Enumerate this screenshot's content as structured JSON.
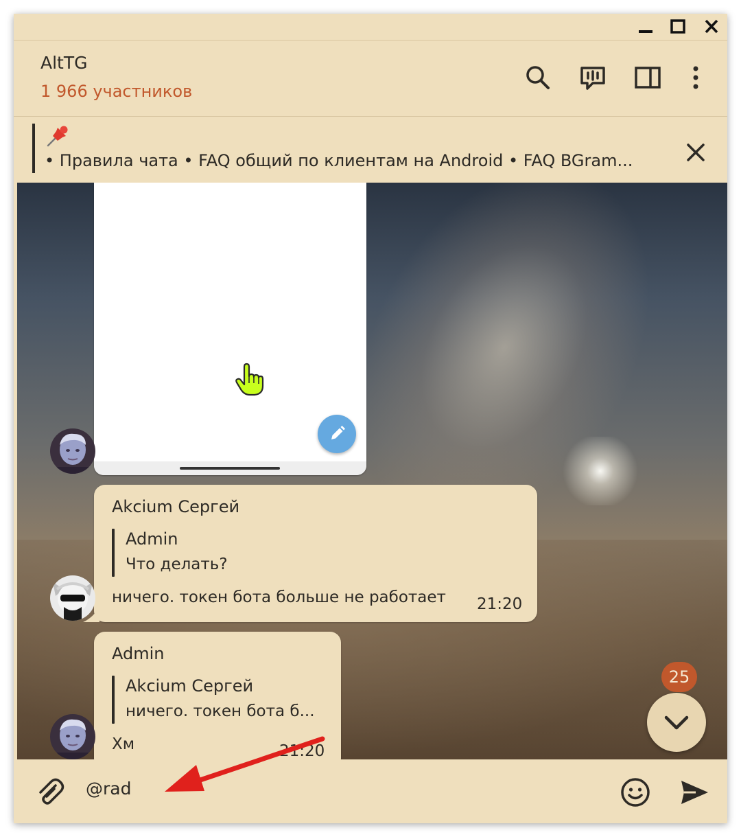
{
  "window": {
    "controls": [
      "minimize-icon",
      "maximize-icon",
      "close-icon"
    ]
  },
  "header": {
    "title": "AltTG",
    "subtitle": "1 966 участников",
    "actions": [
      "search-icon",
      "voice-chat-icon",
      "sidebar-icon",
      "more-icon"
    ]
  },
  "pinned": {
    "icon": "pushpin-icon",
    "text": "• Правила чата  • FAQ общий по клиентам на Android   • FAQ BGram..."
  },
  "messages": [
    {
      "type": "image",
      "edit_icon": "pencil-icon"
    },
    {
      "sender": "Akcium Сергей",
      "reply_to": {
        "name": "Admin",
        "text": "Что делать?"
      },
      "text": "ничего. токен бота больше не работает",
      "time": "21:20"
    },
    {
      "sender": "Admin",
      "reply_to": {
        "name": "Akcium Сергей",
        "text": "ничего. токен бота б..."
      },
      "text": "Хм",
      "time": "21:20"
    }
  ],
  "scroll_down": {
    "unread_count": "25",
    "icon": "chevron-down-icon"
  },
  "composer": {
    "value": "@rad",
    "attach_icon": "paperclip-icon",
    "emoji_icon": "smile-icon",
    "send_icon": "send-icon"
  },
  "colors": {
    "panel": "#efdfbd",
    "accent": "#c1582c",
    "text": "#2d2a25",
    "annotation_arrow": "#e0211c"
  }
}
